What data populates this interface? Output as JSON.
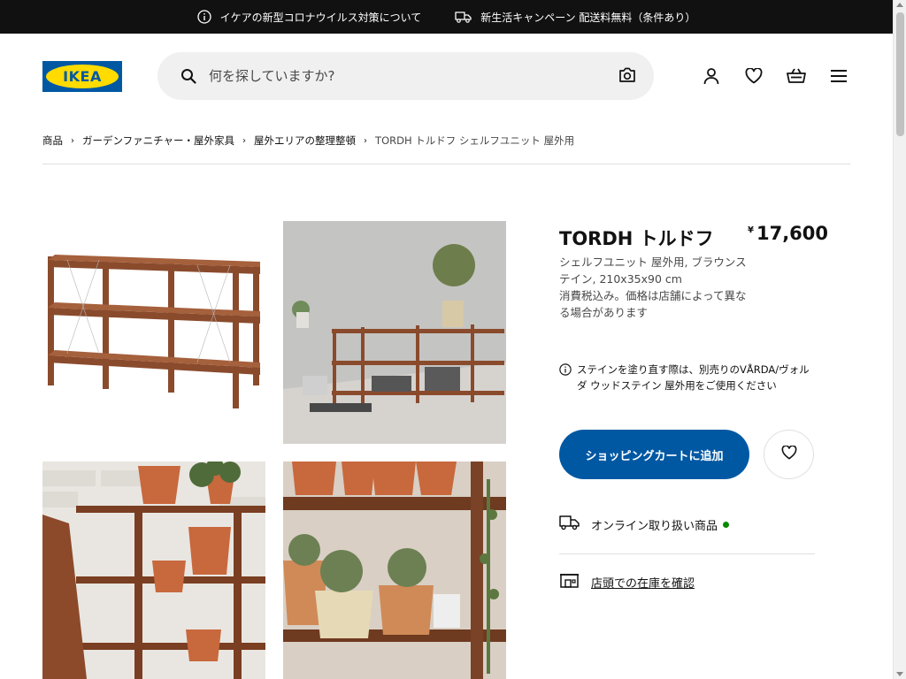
{
  "announcement": {
    "items": [
      {
        "icon": "info-icon",
        "text": "イケアの新型コロナウイルス対策について"
      },
      {
        "icon": "truck-icon",
        "text": "新生活キャンペーン 配送料無料（条件あり）"
      }
    ]
  },
  "header": {
    "logo_text": "IKEA",
    "search_placeholder": "何を探していますか?",
    "icons": [
      "account-icon",
      "wishlist-heart-icon",
      "cart-icon",
      "menu-icon"
    ]
  },
  "breadcrumb": [
    "商品",
    "ガーデンファニチャー・屋外家具",
    "屋外エリアの整理整頓",
    "TORDH トルドフ シェルフユニット 屋外用"
  ],
  "product": {
    "name": "TORDH トルドフ",
    "currency": "¥",
    "price": "17,600",
    "description": "シェルフユニット 屋外用, ブラウンステイン, 210x35x90 cm",
    "tax_note": "消費税込み。価格は店舗によって異なる場合があります",
    "stain_notice": "ステインを塗り直す際は、別売りのVÅRDA/ヴォルダ ウッドステイン 屋外用をご使用ください",
    "add_to_cart_label": "ショッピングカートに追加",
    "online_label": "オンライン取り扱い商品",
    "store_stock_label": "店頭での在庫を確認"
  },
  "colors": {
    "brand_blue": "#0058a3",
    "brand_yellow": "#ffdb00",
    "available_green": "#0a8a00"
  }
}
